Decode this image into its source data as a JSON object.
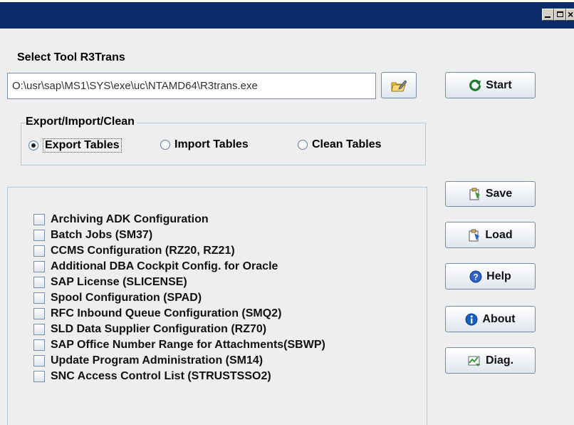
{
  "window": {
    "controls": {
      "minimize": "_",
      "maximize": "□",
      "close": "×"
    }
  },
  "tool": {
    "section_label": "Select Tool R3Trans",
    "path_value": "O:\\usr\\sap\\MS1\\SYS\\exe\\uc\\NTAMD64\\R3trans.exe",
    "browse_icon": "folder-edit-icon",
    "start_label": "Start",
    "start_icon": "refresh-icon"
  },
  "mode_group": {
    "title": "Export/Import/Clean",
    "options": [
      {
        "label": "Export Tables",
        "selected": true
      },
      {
        "label": "Import Tables",
        "selected": false
      },
      {
        "label": "Clean Tables",
        "selected": false
      }
    ]
  },
  "table_items": [
    {
      "label": "Archiving ADK Configuration",
      "checked": false
    },
    {
      "label": "Batch Jobs (SM37)",
      "checked": false
    },
    {
      "label": "CCMS Configuration (RZ20, RZ21)",
      "checked": false
    },
    {
      "label": "Additional DBA Cockpit Config. for Oracle",
      "checked": false
    },
    {
      "label": "SAP License (SLICENSE)",
      "checked": false
    },
    {
      "label": "Spool Configuration (SPAD)",
      "checked": false
    },
    {
      "label": "RFC Inbound Queue Configuration (SMQ2)",
      "checked": false
    },
    {
      "label": "SLD Data Supplier Configuration (RZ70)",
      "checked": false
    },
    {
      "label": "SAP Office Number Range for Attachments(SBWP)",
      "checked": false
    },
    {
      "label": "Update Program Administration (SM14)",
      "checked": false
    },
    {
      "label": "SNC Access Control List (STRUSTSSO2)",
      "checked": false
    }
  ],
  "side_buttons": {
    "save": "Save",
    "load": "Load",
    "help": "Help",
    "about": "About",
    "diag": "Diag."
  },
  "colors": {
    "titlebar": "#0b2a6a",
    "background": "#eeeeee",
    "start_icon": "#1f7a2e",
    "help_icon": "#2c62c8",
    "about_icon": "#1a5fc0"
  }
}
